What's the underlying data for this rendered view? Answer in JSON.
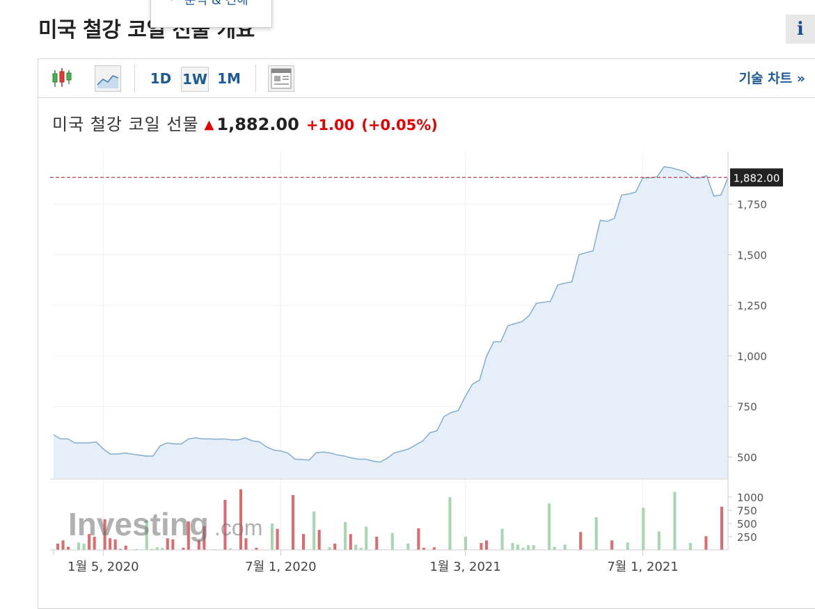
{
  "page": {
    "title": "미국 철강 코일 선물 개요",
    "dropdown_item": "분석 & 견해",
    "info_label": "i"
  },
  "toolbar": {
    "icons": [
      "candlestick-icon",
      "area-chart-icon",
      "news-layout-icon"
    ],
    "timeframes": [
      {
        "label": "1D",
        "active": false
      },
      {
        "label": "1W",
        "active": true
      },
      {
        "label": "1M",
        "active": false
      }
    ],
    "tech_chart_label": "기술 차트 »"
  },
  "quote": {
    "name": "미국 철강 코일 선물",
    "price": "1,882.00",
    "change": "+1.00",
    "change_pct": "(+0.05%)"
  },
  "colors": {
    "line": "#7ba9cc",
    "area": "#e6eef7",
    "up_volume": "#a6d7b0",
    "down_volume": "#dc6c70",
    "price_line": "#b43e4a",
    "link": "#1d5a96",
    "change": "#e60000"
  },
  "chart_data": {
    "type": "area",
    "x_ticks": [
      {
        "label": "1월 5, 2020",
        "index": 7
      },
      {
        "label": "7월 1, 2020",
        "index": 32
      },
      {
        "label": "1월 3, 2021",
        "index": 58
      },
      {
        "label": "7월 1, 2021",
        "index": 83
      }
    ],
    "y_ticks": [
      500,
      750,
      1000,
      1250,
      1500,
      1750
    ],
    "y_tick_labels": [
      "500",
      "750",
      "1,000",
      "1,250",
      "1,500",
      "1,750"
    ],
    "ylim": [
      395,
      2010
    ],
    "current_price": 1882,
    "current_price_label": "1,882.00",
    "values": [
      610,
      590,
      590,
      570,
      570,
      570,
      575,
      540,
      515,
      515,
      520,
      515,
      510,
      505,
      505,
      555,
      570,
      565,
      565,
      590,
      595,
      590,
      590,
      588,
      590,
      585,
      585,
      595,
      580,
      575,
      550,
      535,
      530,
      520,
      490,
      488,
      485,
      522,
      525,
      520,
      510,
      505,
      495,
      490,
      490,
      480,
      475,
      495,
      520,
      530,
      540,
      560,
      580,
      620,
      630,
      700,
      720,
      730,
      800,
      860,
      880,
      1000,
      1070,
      1070,
      1150,
      1160,
      1170,
      1200,
      1260,
      1265,
      1270,
      1350,
      1360,
      1365,
      1500,
      1510,
      1520,
      1670,
      1665,
      1680,
      1795,
      1800,
      1810,
      1880,
      1880,
      1885,
      1935,
      1930,
      1920,
      1910,
      1880,
      1880,
      1890,
      1790,
      1795,
      1880
    ],
    "volume_ticks": [
      250,
      500,
      750,
      1000
    ],
    "volume_tick_labels": [
      "250",
      "500",
      "750",
      "1000"
    ],
    "volume_max": 1120,
    "volume": [
      120,
      180,
      60,
      0,
      140,
      120,
      300,
      250,
      0,
      580,
      220,
      200,
      20,
      80,
      0,
      20,
      0,
      560,
      20,
      50,
      40,
      220,
      200,
      0,
      40,
      540,
      0,
      180,
      450,
      0,
      10,
      0,
      950,
      30,
      0,
      1150,
      220,
      0,
      40,
      0,
      0,
      500,
      400,
      0,
      0,
      1040,
      0,
      300,
      0,
      730,
      380,
      0,
      50,
      120,
      0,
      530,
      300,
      100,
      40,
      440,
      0,
      250,
      0,
      0,
      320,
      0,
      0,
      120,
      0,
      410,
      40,
      0,
      50,
      0,
      0,
      1000,
      0,
      0,
      250,
      0,
      0,
      130,
      180,
      0,
      0,
      400,
      0,
      130,
      100,
      40,
      90,
      90,
      0,
      0,
      880,
      60,
      0,
      100,
      0,
      0,
      340,
      0,
      0,
      620,
      0,
      0,
      180,
      0,
      0,
      140,
      0,
      0,
      800,
      0,
      0,
      350,
      0,
      0,
      1100,
      0,
      0,
      130,
      0,
      0,
      260,
      0,
      0,
      820,
      0
    ],
    "volume_colors": [
      "d",
      "d",
      "d",
      "d",
      "u",
      "u",
      "d",
      "d",
      "d",
      "d",
      "d",
      "d",
      "d",
      "d",
      "u",
      "u",
      "u",
      "u",
      "u",
      "u",
      "u",
      "d",
      "d",
      "d",
      "d",
      "d",
      "u",
      "d",
      "d",
      "u",
      "u",
      "u",
      "d",
      "u",
      "u",
      "d",
      "d",
      "u",
      "d",
      "u",
      "u",
      "u",
      "d",
      "d",
      "u",
      "d",
      "u",
      "d",
      "u",
      "u",
      "d",
      "d",
      "u",
      "d",
      "u",
      "u",
      "d",
      "u",
      "u",
      "u",
      "u",
      "d",
      "u",
      "u",
      "u",
      "u",
      "u",
      "u",
      "u",
      "d",
      "d",
      "d",
      "d",
      "u",
      "d",
      "u",
      "u",
      "d",
      "u",
      "u",
      "u",
      "d",
      "d",
      "u",
      "d",
      "u",
      "u",
      "u",
      "u",
      "u",
      "u",
      "u",
      "u",
      "u",
      "u",
      "u",
      "u",
      "u",
      "d",
      "d",
      "d",
      "d",
      "d",
      "u",
      "u",
      "d",
      "d",
      "u",
      "u",
      "u",
      "u",
      "u",
      "u",
      "u",
      "u",
      "u",
      "u",
      "u",
      "u",
      "d",
      "d",
      "u",
      "u",
      "d",
      "d",
      "u",
      "u",
      "d",
      "u",
      "u",
      "u",
      "u",
      "u",
      "u"
    ]
  }
}
